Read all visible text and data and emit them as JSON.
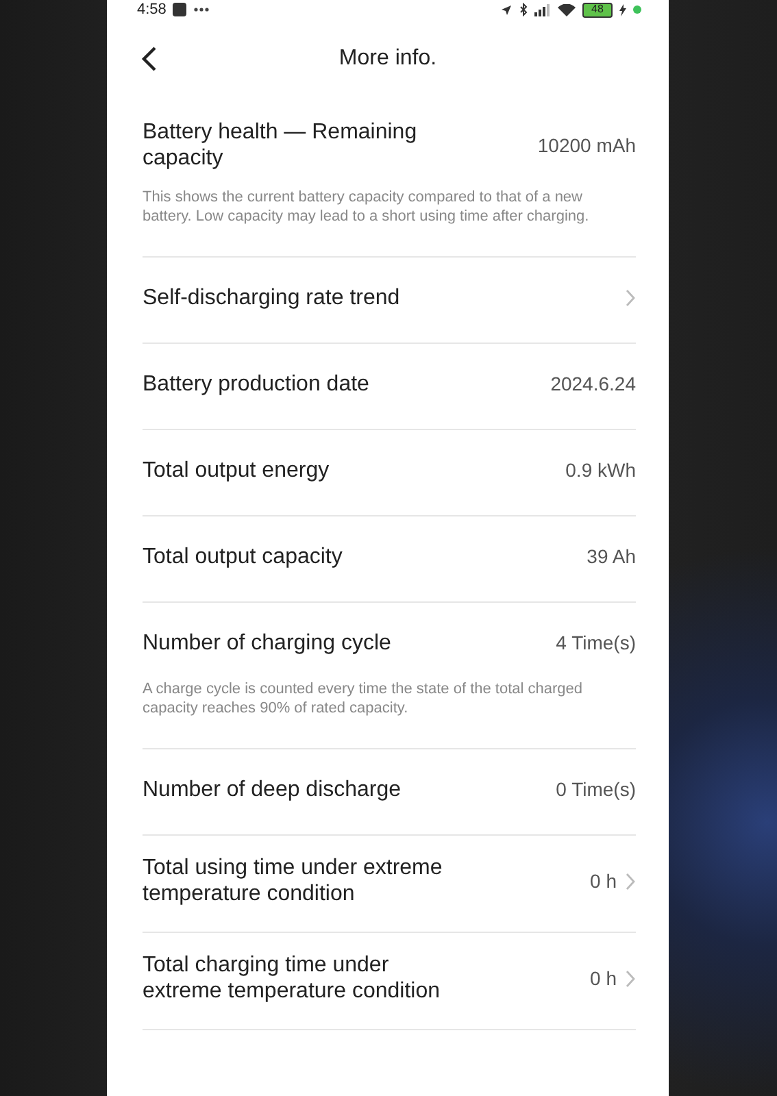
{
  "status_bar": {
    "time": "4:58",
    "battery": "48"
  },
  "header": {
    "title": "More info."
  },
  "items": [
    {
      "title": "Battery health — Remaining capacity",
      "value": "10200 mAh",
      "chevron": false,
      "description": "This shows the current battery capacity compared to that of a new battery. Low capacity may lead to a short using time after charging."
    },
    {
      "title": "Self-discharging rate trend",
      "chevron": true
    },
    {
      "title": "Battery production date",
      "value": "2024.6.24",
      "chevron": false
    },
    {
      "title": "Total output energy",
      "value": "0.9 kWh",
      "chevron": false
    },
    {
      "title": "Total output capacity",
      "value": "39 Ah",
      "chevron": false
    },
    {
      "title": "Number of charging cycle",
      "value": "4 Time(s)",
      "chevron": false,
      "description": "A charge cycle is counted every time the state of the total charged capacity reaches 90% of rated capacity."
    },
    {
      "title": "Number of deep discharge",
      "value": "0 Time(s)",
      "chevron": false
    },
    {
      "title": "Total using time under extreme temperature condition",
      "value": "0 h",
      "chevron": true
    },
    {
      "title": "Total charging time under extreme temperature condition",
      "value": "0 h",
      "chevron": true
    }
  ]
}
